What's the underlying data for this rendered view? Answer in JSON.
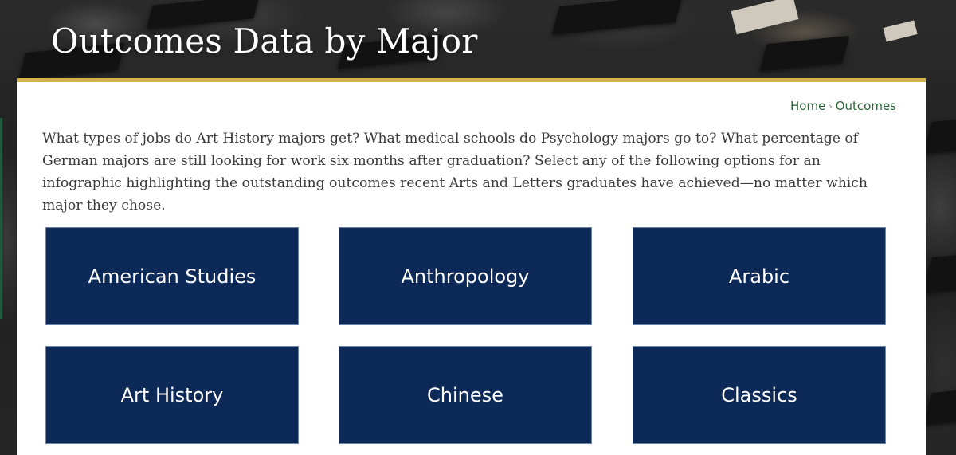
{
  "page": {
    "title": "Outcomes Data by Major"
  },
  "breadcrumb": {
    "home": "Home",
    "separator": "›",
    "current": "Outcomes"
  },
  "intro": {
    "text": "What types of jobs do Art History majors get? What medical schools do Psychology majors go to? What percentage of German majors are still looking for work six months after graduation? Select any of the following options for an infographic highlighting the outstanding outcomes recent Arts and Letters graduates have achieved—no matter which major they chose."
  },
  "majors": [
    {
      "label": "American Studies"
    },
    {
      "label": "Anthropology"
    },
    {
      "label": "Arabic"
    },
    {
      "label": "Art History"
    },
    {
      "label": "Chinese"
    },
    {
      "label": "Classics"
    }
  ],
  "colors": {
    "button_bg": "#0c2957",
    "accent_gold": "#d6b24a",
    "breadcrumb_green": "#2b6338"
  }
}
